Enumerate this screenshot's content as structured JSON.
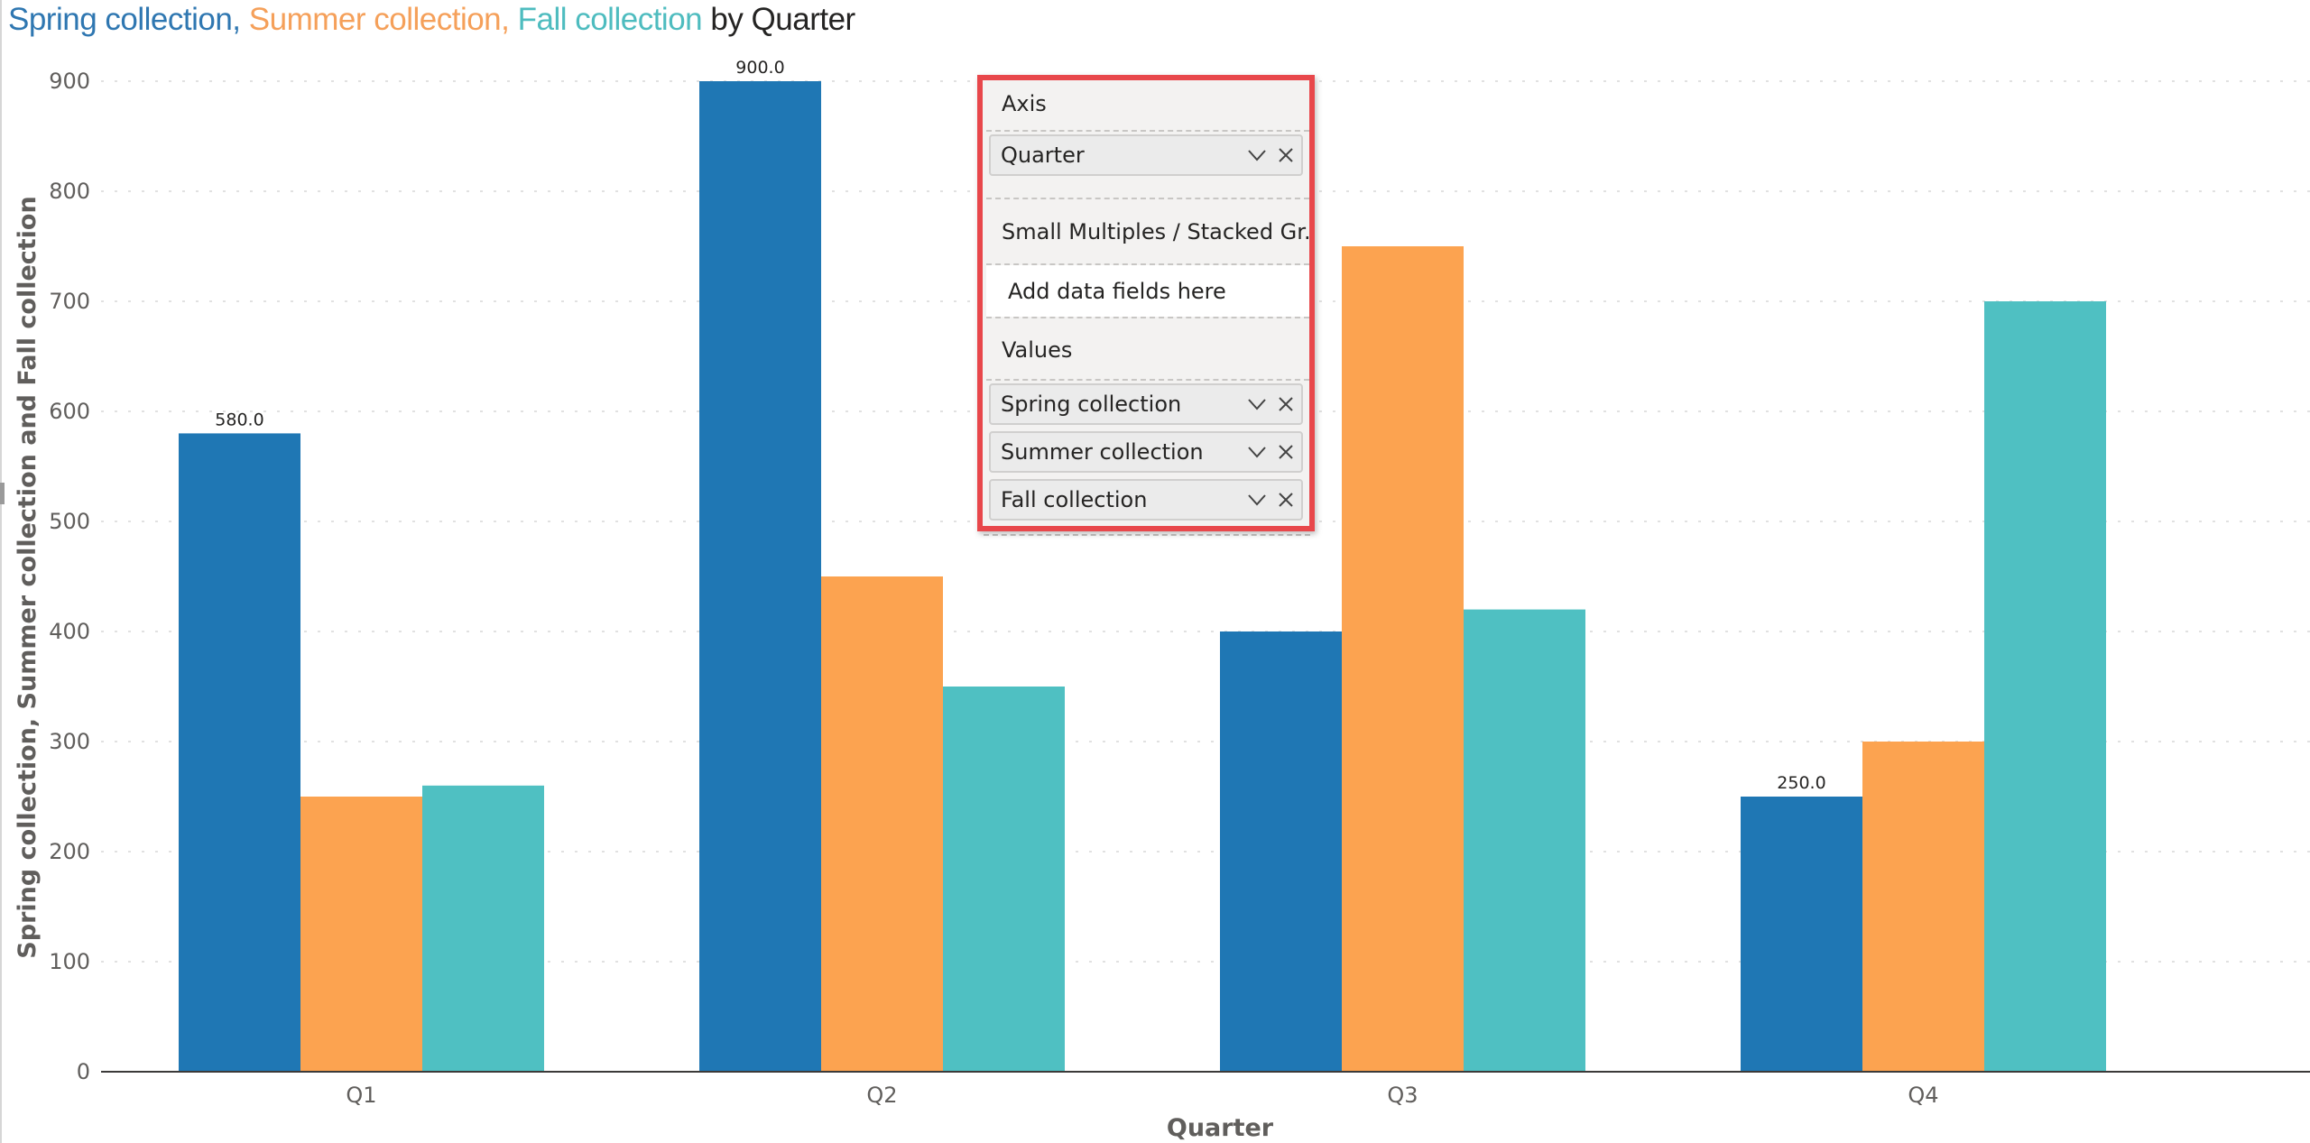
{
  "title": {
    "parts": [
      {
        "text": "Spring collection, ",
        "color": "#2f77b1"
      },
      {
        "text": "Summer collection, ",
        "color": "#f5a05a"
      },
      {
        "text": "Fall collection",
        "color": "#4ebcbf"
      },
      {
        "text": " by Quarter",
        "color": "#252423"
      }
    ]
  },
  "colors": {
    "spring": "#1f77b4",
    "summer": "#fca350",
    "fall": "#4fc0c2",
    "highlight_border": "#e8474b"
  },
  "chart_data": {
    "type": "bar",
    "title": "Spring collection, Summer collection, Fall collection by Quarter",
    "categories": [
      "Q1",
      "Q2",
      "Q3",
      "Q4"
    ],
    "series": [
      {
        "name": "Spring collection",
        "values": [
          580,
          900,
          400,
          250
        ],
        "color": "#1f77b4"
      },
      {
        "name": "Summer collection",
        "values": [
          250,
          450,
          750,
          300
        ],
        "color": "#fca350"
      },
      {
        "name": "Fall collection",
        "values": [
          260,
          350,
          420,
          700
        ],
        "color": "#4fc0c2"
      }
    ],
    "data_labels": [
      {
        "series": "Spring collection",
        "category": "Q1",
        "text": "580.0"
      },
      {
        "series": "Spring collection",
        "category": "Q2",
        "text": "900.0"
      },
      {
        "series": "Spring collection",
        "category": "Q4",
        "text": "250.0"
      }
    ],
    "xlabel": "Quarter",
    "ylabel": "Spring collection, Summer collection and Fall collection",
    "ylim": [
      0,
      900
    ],
    "yticks": [
      0,
      100,
      200,
      300,
      400,
      500,
      600,
      700,
      800,
      900
    ],
    "grid": true,
    "legend": "none"
  },
  "field_wells": {
    "axis": {
      "header": "Axis",
      "fields": [
        {
          "label": "Quarter"
        }
      ]
    },
    "small_multiples": {
      "header": "Small Multiples / Stacked Gr...",
      "placeholder": "Add data fields here"
    },
    "values": {
      "header": "Values",
      "fields": [
        {
          "label": "Spring collection"
        },
        {
          "label": "Summer collection"
        },
        {
          "label": "Fall collection"
        }
      ]
    }
  }
}
